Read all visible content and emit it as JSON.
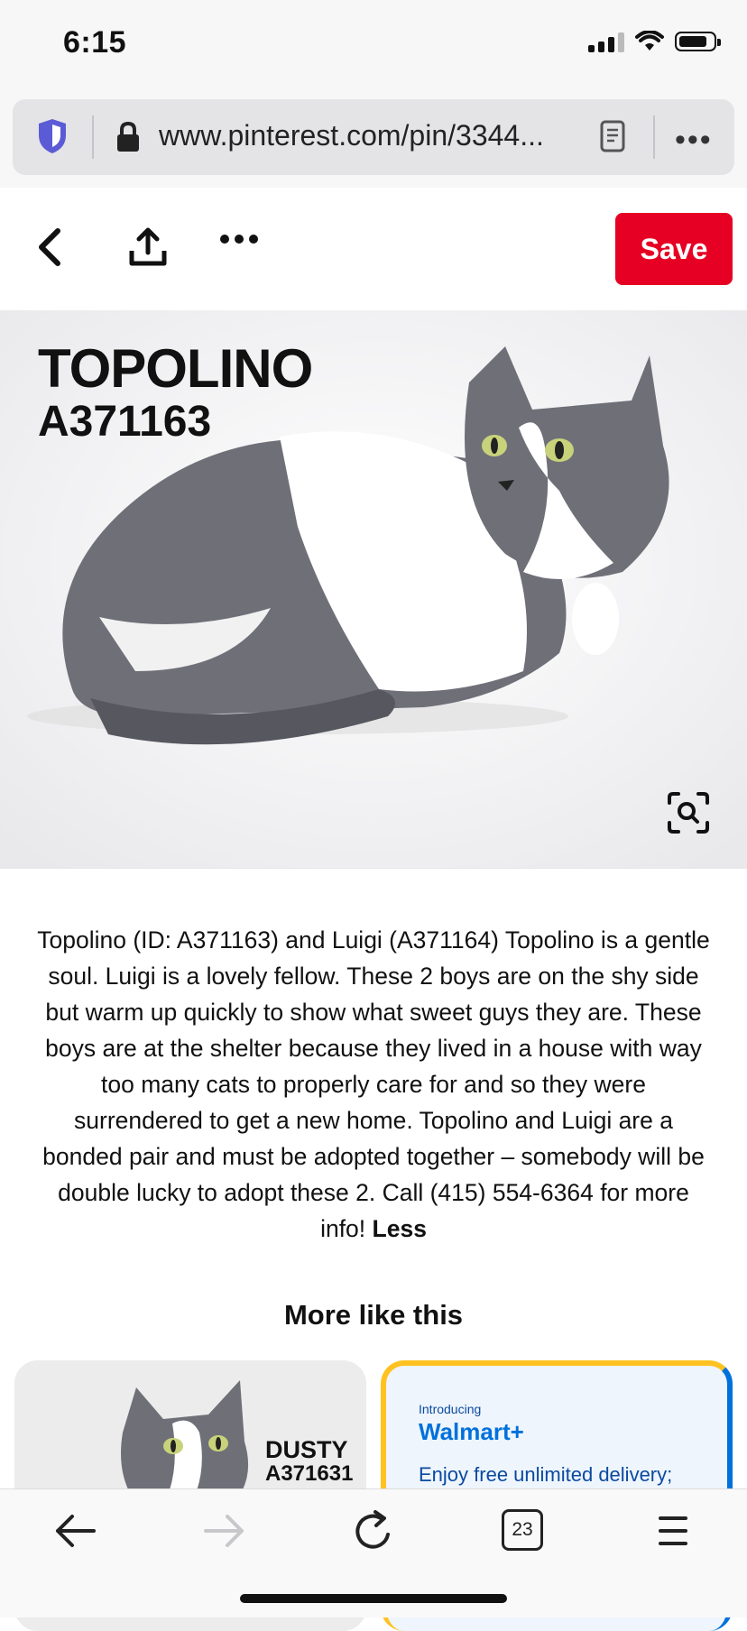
{
  "status": {
    "time": "6:15"
  },
  "browser": {
    "url": "www.pinterest.com/pin/3344...",
    "tab_count": "23"
  },
  "pin": {
    "save_label": "Save",
    "image_name": "TOPOLINO",
    "image_id": "A371163",
    "description": "Topolino (ID: A371163) and Luigi (A371164) Topolino is a gentle soul. Luigi is a lovely fellow. These 2 boys are on the shy side but warm up quickly to show what sweet guys they are. These boys are at the shelter because they lived in a house with way too many cats to properly care for and so they were surrendered to get a new home. Topolino and Luigi are a bonded pair and must be adopted together – somebody will be double lucky to adopt these 2. Call (415) 554-6364 for more info!",
    "less_label": "Less"
  },
  "more_like_this": {
    "title": "More like this",
    "cards": [
      {
        "name": "DUSTY",
        "id": "A371631"
      },
      {
        "intro": "Introducing",
        "brand": "Walmart+",
        "promo": "Enjoy free unlimited delivery;"
      }
    ]
  },
  "colors": {
    "save_red": "#e60023",
    "walmart_blue": "#0071dc",
    "walmart_yellow": "#ffc220"
  }
}
